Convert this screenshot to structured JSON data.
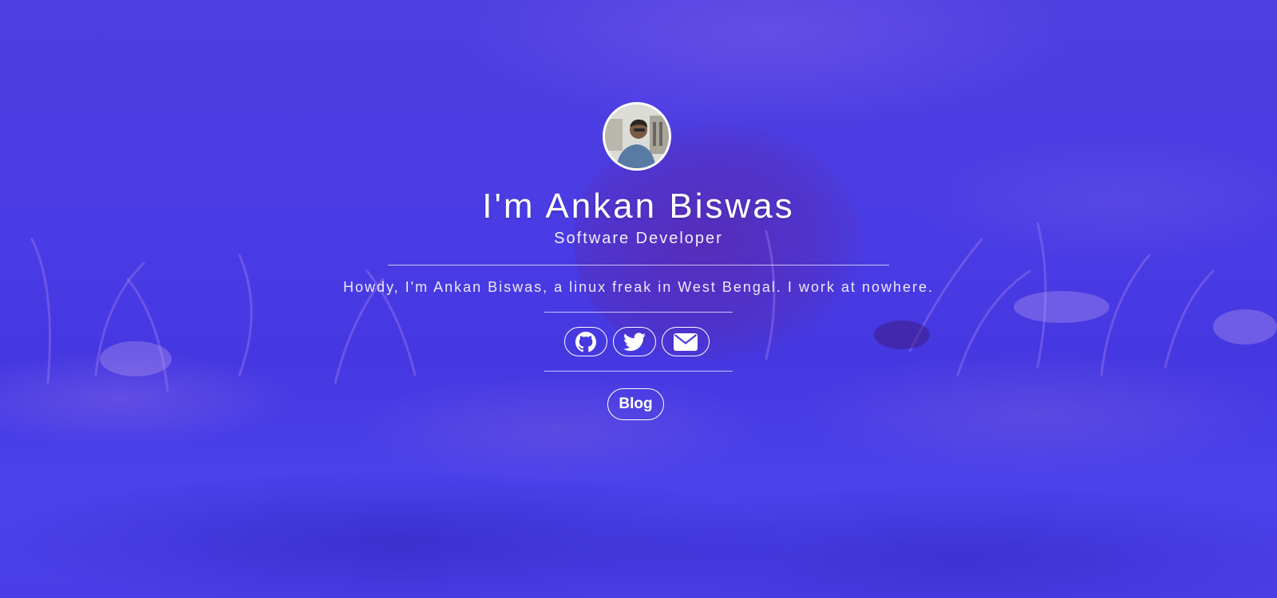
{
  "profile": {
    "name": "I'm Ankan Biswas",
    "role": "Software Developer",
    "bio": "Howdy, I'm Ankan Biswas, a linux freak in West Bengal. I work at nowhere."
  },
  "social": {
    "icons": [
      "github-icon",
      "twitter-icon",
      "envelope-icon"
    ]
  },
  "nav": {
    "blog_label": "Blog"
  },
  "colors": {
    "background": "#4a3de4",
    "text": "#ffffff"
  }
}
